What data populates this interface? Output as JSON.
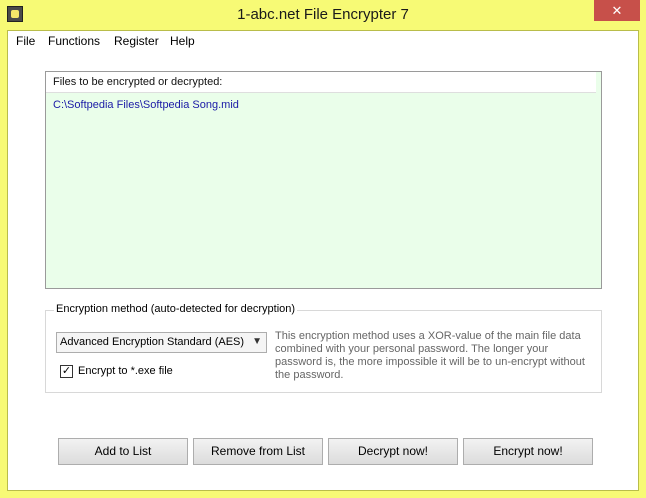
{
  "window": {
    "title": "1-abc.net File Encrypter 7",
    "close_label": "✕"
  },
  "menu": {
    "items": [
      "File",
      "Functions",
      "Register",
      "Help"
    ]
  },
  "filelist": {
    "header": "Files to be encrypted or decrypted:",
    "files": [
      "C:\\Softpedia Files\\Softpedia Song.mid"
    ]
  },
  "encryption": {
    "group_label": "Encryption method (auto-detected for decryption)",
    "selected_method": "Advanced Encryption Standard (AES)",
    "description": "This encryption method uses a XOR-value of the main file data combined with your personal password. The longer your password is, the more impossible it will be to un-encrypt without the password.",
    "exe_checkbox_label": "Encrypt to *.exe file",
    "exe_checked": true,
    "check_glyph": "✓"
  },
  "buttons": {
    "add": "Add to List",
    "remove": "Remove from List",
    "decrypt": "Decrypt now!",
    "encrypt": "Encrypt now!"
  },
  "colors": {
    "frame": "#f7fa75",
    "list_background": "#eafeea",
    "file_text": "#1a1aa6",
    "close_button": "#c7504a"
  }
}
